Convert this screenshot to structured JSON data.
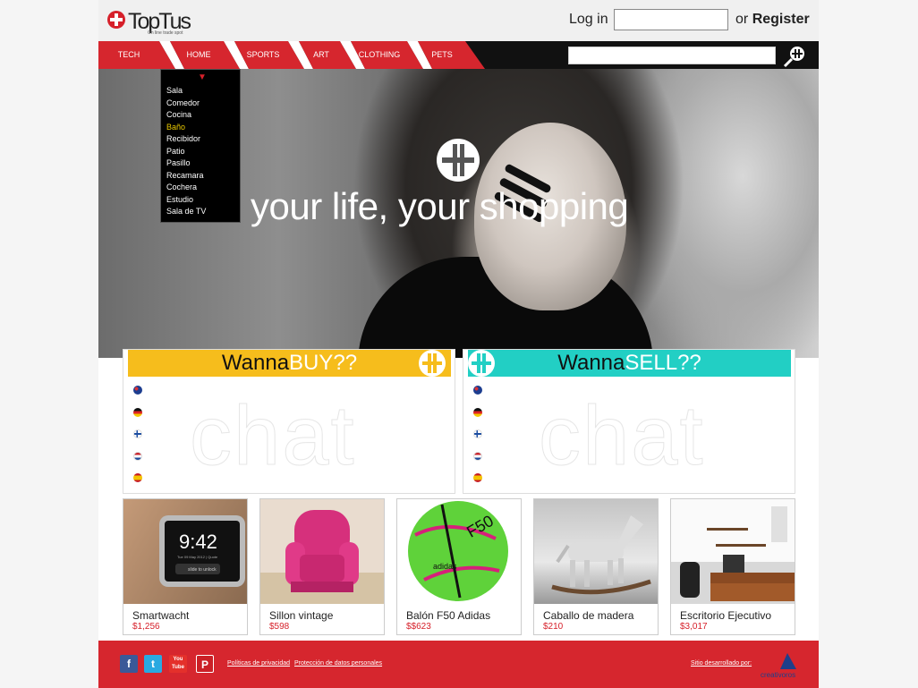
{
  "brand": {
    "name": "TopTus",
    "tagline": "On line trade spot",
    "red": "#d6202a"
  },
  "auth": {
    "login_label": "Log in",
    "register_prefix": "or",
    "register_label": "Register"
  },
  "nav": {
    "items": [
      "TECH",
      "HOME",
      "SPORTS",
      "ART",
      "CLOTHING",
      "PETS"
    ],
    "search_placeholder": "",
    "search_icon": "toptus-magnifier-icon"
  },
  "dropdown": {
    "items": [
      "Sala",
      "Comedor",
      "Cocina",
      "Baño",
      "Recibidor",
      "Patio",
      "Pasillo",
      "Recamara",
      "Cochera",
      "Estudio",
      "Sala de TV"
    ],
    "active": "Baño"
  },
  "hero": {
    "tagline": "your life, your shopping"
  },
  "panels": {
    "buy": {
      "word": "Wanna",
      "accent": "BUY??",
      "color": "#f6bd1c",
      "watermark": "chat"
    },
    "sell": {
      "word": "Wanna",
      "accent": "SELL??",
      "color": "#22cfc4",
      "watermark": "chat"
    },
    "flags": [
      "australia-flag-icon",
      "germany-flag-icon",
      "finland-flag-icon",
      "netherlands-flag-icon",
      "spain-flag-icon"
    ]
  },
  "products": [
    {
      "name": "Smartwacht",
      "price": "$1,256"
    },
    {
      "name": "Sillon vintage",
      "price": "$598"
    },
    {
      "name": "Balón F50 Adidas",
      "price": "$$623"
    },
    {
      "name": "Caballo de madera",
      "price": "$210"
    },
    {
      "name": "Escritorio Ejecutivo",
      "price": "$3,017"
    }
  ],
  "footer": {
    "social": [
      "facebook-icon",
      "twitter-icon",
      "youtube-icon",
      "pinterest-icon"
    ],
    "youtube_label": "You Tube",
    "links": [
      "Políticas de privacidad",
      "Protección de datos personales"
    ],
    "credit": "Sitio desarrollado por:",
    "dev_name": "creativoros"
  },
  "watch": {
    "time": "9:42",
    "date": "Tue 09 May 2012 | Quote",
    "unlock": "slide to unlock"
  },
  "ball": {
    "model": "F50",
    "brand": "adidas"
  }
}
